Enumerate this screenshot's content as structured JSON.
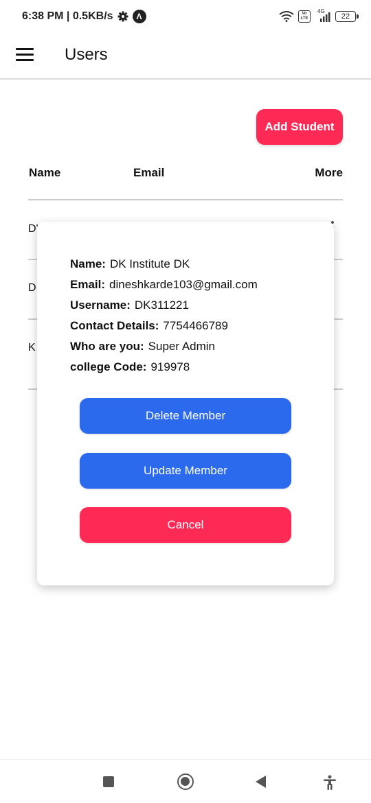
{
  "status_bar": {
    "time_speed": "6:38 PM | 0.5KB/s",
    "network": "4G",
    "volte": "Vo LTE",
    "battery": "22"
  },
  "app_bar": {
    "title": "Users"
  },
  "actions": {
    "add_student": "Add Student"
  },
  "table": {
    "headers": {
      "name": "Name",
      "email": "Email",
      "more": "More"
    },
    "rows": [
      {
        "name_partial": "D'"
      },
      {
        "name_partial": "D"
      },
      {
        "name_partial": "K"
      }
    ]
  },
  "modal": {
    "fields": [
      {
        "label": "Name:",
        "value": "DK Institute DK"
      },
      {
        "label": "Email:",
        "value": "dineshkarde103@gmail.com"
      },
      {
        "label": "Username:",
        "value": "DK311221"
      },
      {
        "label": "Contact Details:",
        "value": "7754466789"
      },
      {
        "label": "Who are you:",
        "value": "Super Admin"
      },
      {
        "label": "college Code:",
        "value": "919978"
      }
    ],
    "delete_label": "Delete Member",
    "update_label": "Update Member",
    "cancel_label": "Cancel"
  },
  "colors": {
    "accent_red": "#fd2a55",
    "accent_blue": "#2b6aed"
  },
  "icons": [
    "gear-icon",
    "wifi-icon",
    "signal-icon",
    "battery-icon",
    "menu-icon",
    "more-vert-icon",
    "nav-recents-icon",
    "nav-home-icon",
    "nav-back-icon",
    "accessibility-icon"
  ]
}
